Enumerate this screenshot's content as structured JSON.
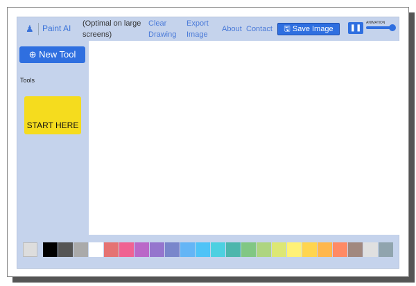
{
  "header": {
    "brand": "Paint AI",
    "note": "(Optimal on large screens)",
    "clear": "Clear Drawing",
    "export": "Export Image",
    "about": "About",
    "contact": "Contact",
    "save": "Save Image",
    "animation_label": "ANIMATION",
    "animation_value": 1.0
  },
  "sidebar": {
    "new_tool": "New Tool",
    "tools_label": "Tools",
    "start": "START HERE"
  },
  "palette": {
    "current": "#dddddd",
    "colors": [
      "#000000",
      "#555555",
      "#aaaaaa",
      "#ffffff",
      "#e57373",
      "#f06292",
      "#ba68c8",
      "#9575cd",
      "#7986cb",
      "#64b5f6",
      "#4fc3f7",
      "#4dd0e1",
      "#4db6ac",
      "#81c784",
      "#aed581",
      "#dce775",
      "#fff176",
      "#ffd54f",
      "#ffb74d",
      "#ff8a65",
      "#a1887f",
      "#e0e0e0",
      "#90a4ae"
    ]
  }
}
